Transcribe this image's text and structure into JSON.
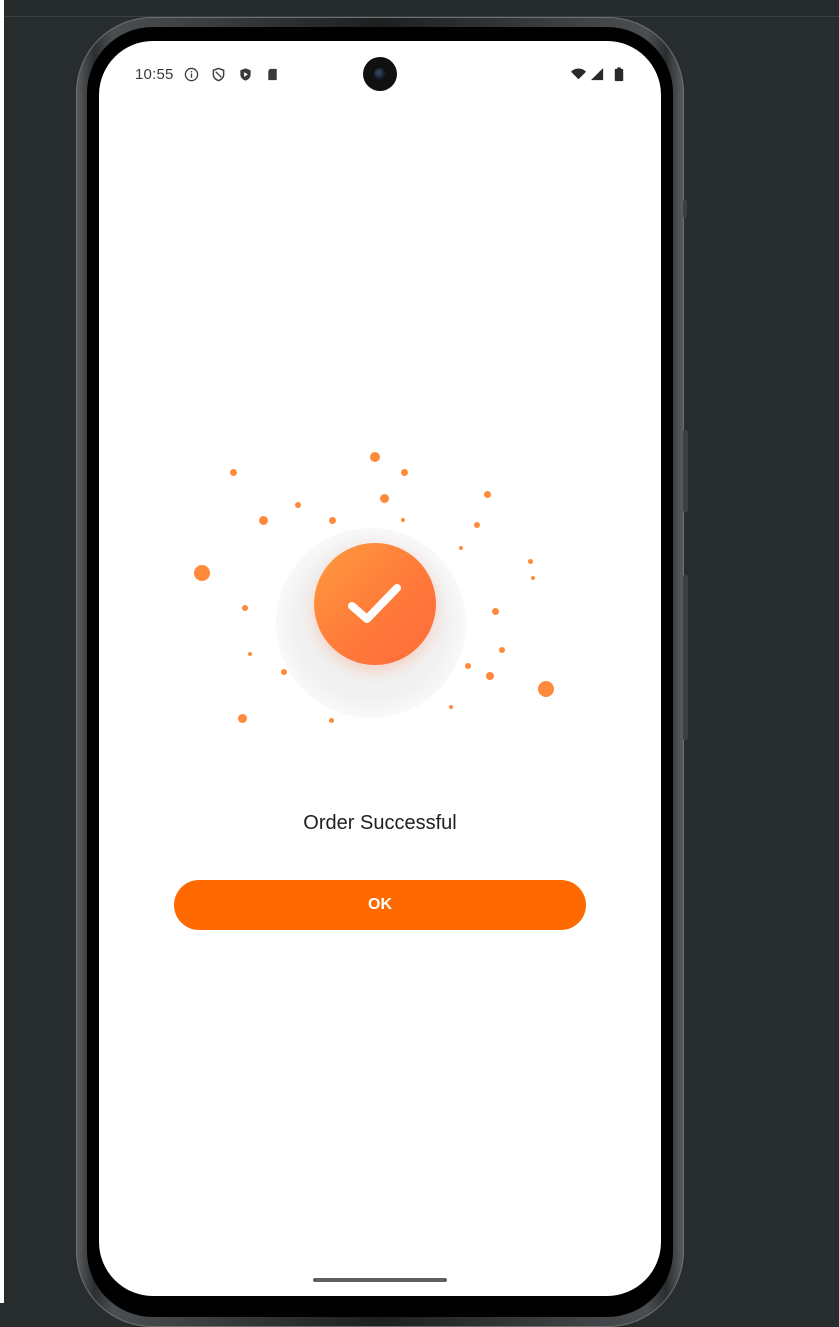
{
  "status_bar": {
    "time": "10:55",
    "left_icons": [
      "info-icon",
      "shield-icon",
      "shield-play-icon",
      "sd-card-icon"
    ],
    "right_icons": [
      "wifi-icon",
      "cellular-signal-icon",
      "battery-icon"
    ]
  },
  "dialog": {
    "title": "Order Successful",
    "ok_label": "OK",
    "icon": "checkmark-icon"
  },
  "colors": {
    "accent": "#ff6a00",
    "check_gradient_start": "#ff9a3e",
    "check_gradient_end": "#ff6a3a",
    "confetti": "#ff8a3c",
    "background": "#272c2d",
    "screen": "#ffffff"
  }
}
